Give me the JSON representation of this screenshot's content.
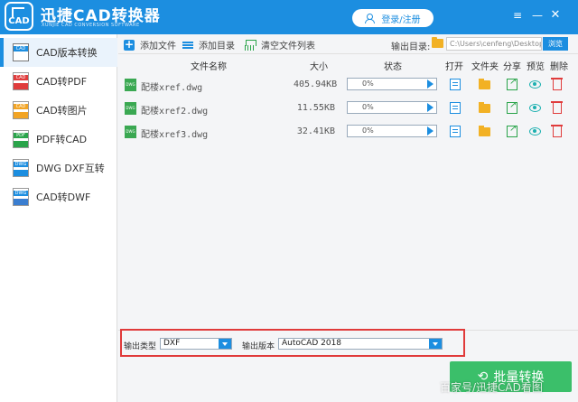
{
  "app": {
    "title": "迅捷CAD转换器",
    "subtitle": "XUNJIE CAD CONVERSION SOFTWARE",
    "logo_text": "CAD",
    "login_label": "登录/注册",
    "accent": "#1c8ee0"
  },
  "sidebar": {
    "items": [
      {
        "label": "CAD版本转换",
        "icon": "cad-version-icon",
        "active": true
      },
      {
        "label": "CAD转PDF",
        "icon": "cad-pdf-icon",
        "active": false
      },
      {
        "label": "CAD转图片",
        "icon": "cad-image-icon",
        "active": false
      },
      {
        "label": "PDF转CAD",
        "icon": "pdf-cad-icon",
        "active": false
      },
      {
        "label": "DWG DXF互转",
        "icon": "dwg-dxf-icon",
        "active": false
      },
      {
        "label": "CAD转DWF",
        "icon": "cad-dwf-icon",
        "active": false
      }
    ]
  },
  "toolbar": {
    "add_file": "添加文件",
    "add_dir": "添加目录",
    "clear_list": "清空文件列表",
    "output_dir_label": "输出目录:",
    "output_path": "C:\\Users\\cenfeng\\Desktop",
    "browse": "浏览"
  },
  "table": {
    "headers": {
      "name": "文件名称",
      "size": "大小",
      "status": "状态",
      "open": "打开",
      "folder": "文件夹",
      "share": "分享",
      "preview": "预览",
      "delete": "删除"
    },
    "rows": [
      {
        "name": "配楼xref.dwg",
        "size": "405.94KB",
        "progress": "0%",
        "progress_value": 0
      },
      {
        "name": "配楼xref2.dwg",
        "size": "11.55KB",
        "progress": "0%",
        "progress_value": 0
      },
      {
        "name": "配楼xref3.dwg",
        "size": "32.41KB",
        "progress": "0%",
        "progress_value": 0
      }
    ]
  },
  "options": {
    "output_type_label": "输出类型",
    "output_type_value": "DXF",
    "output_version_label": "输出版本",
    "output_version_value": "AutoCAD 2018"
  },
  "convert_label": "批量转换",
  "watermark": "百家号/迅捷CAD看图"
}
